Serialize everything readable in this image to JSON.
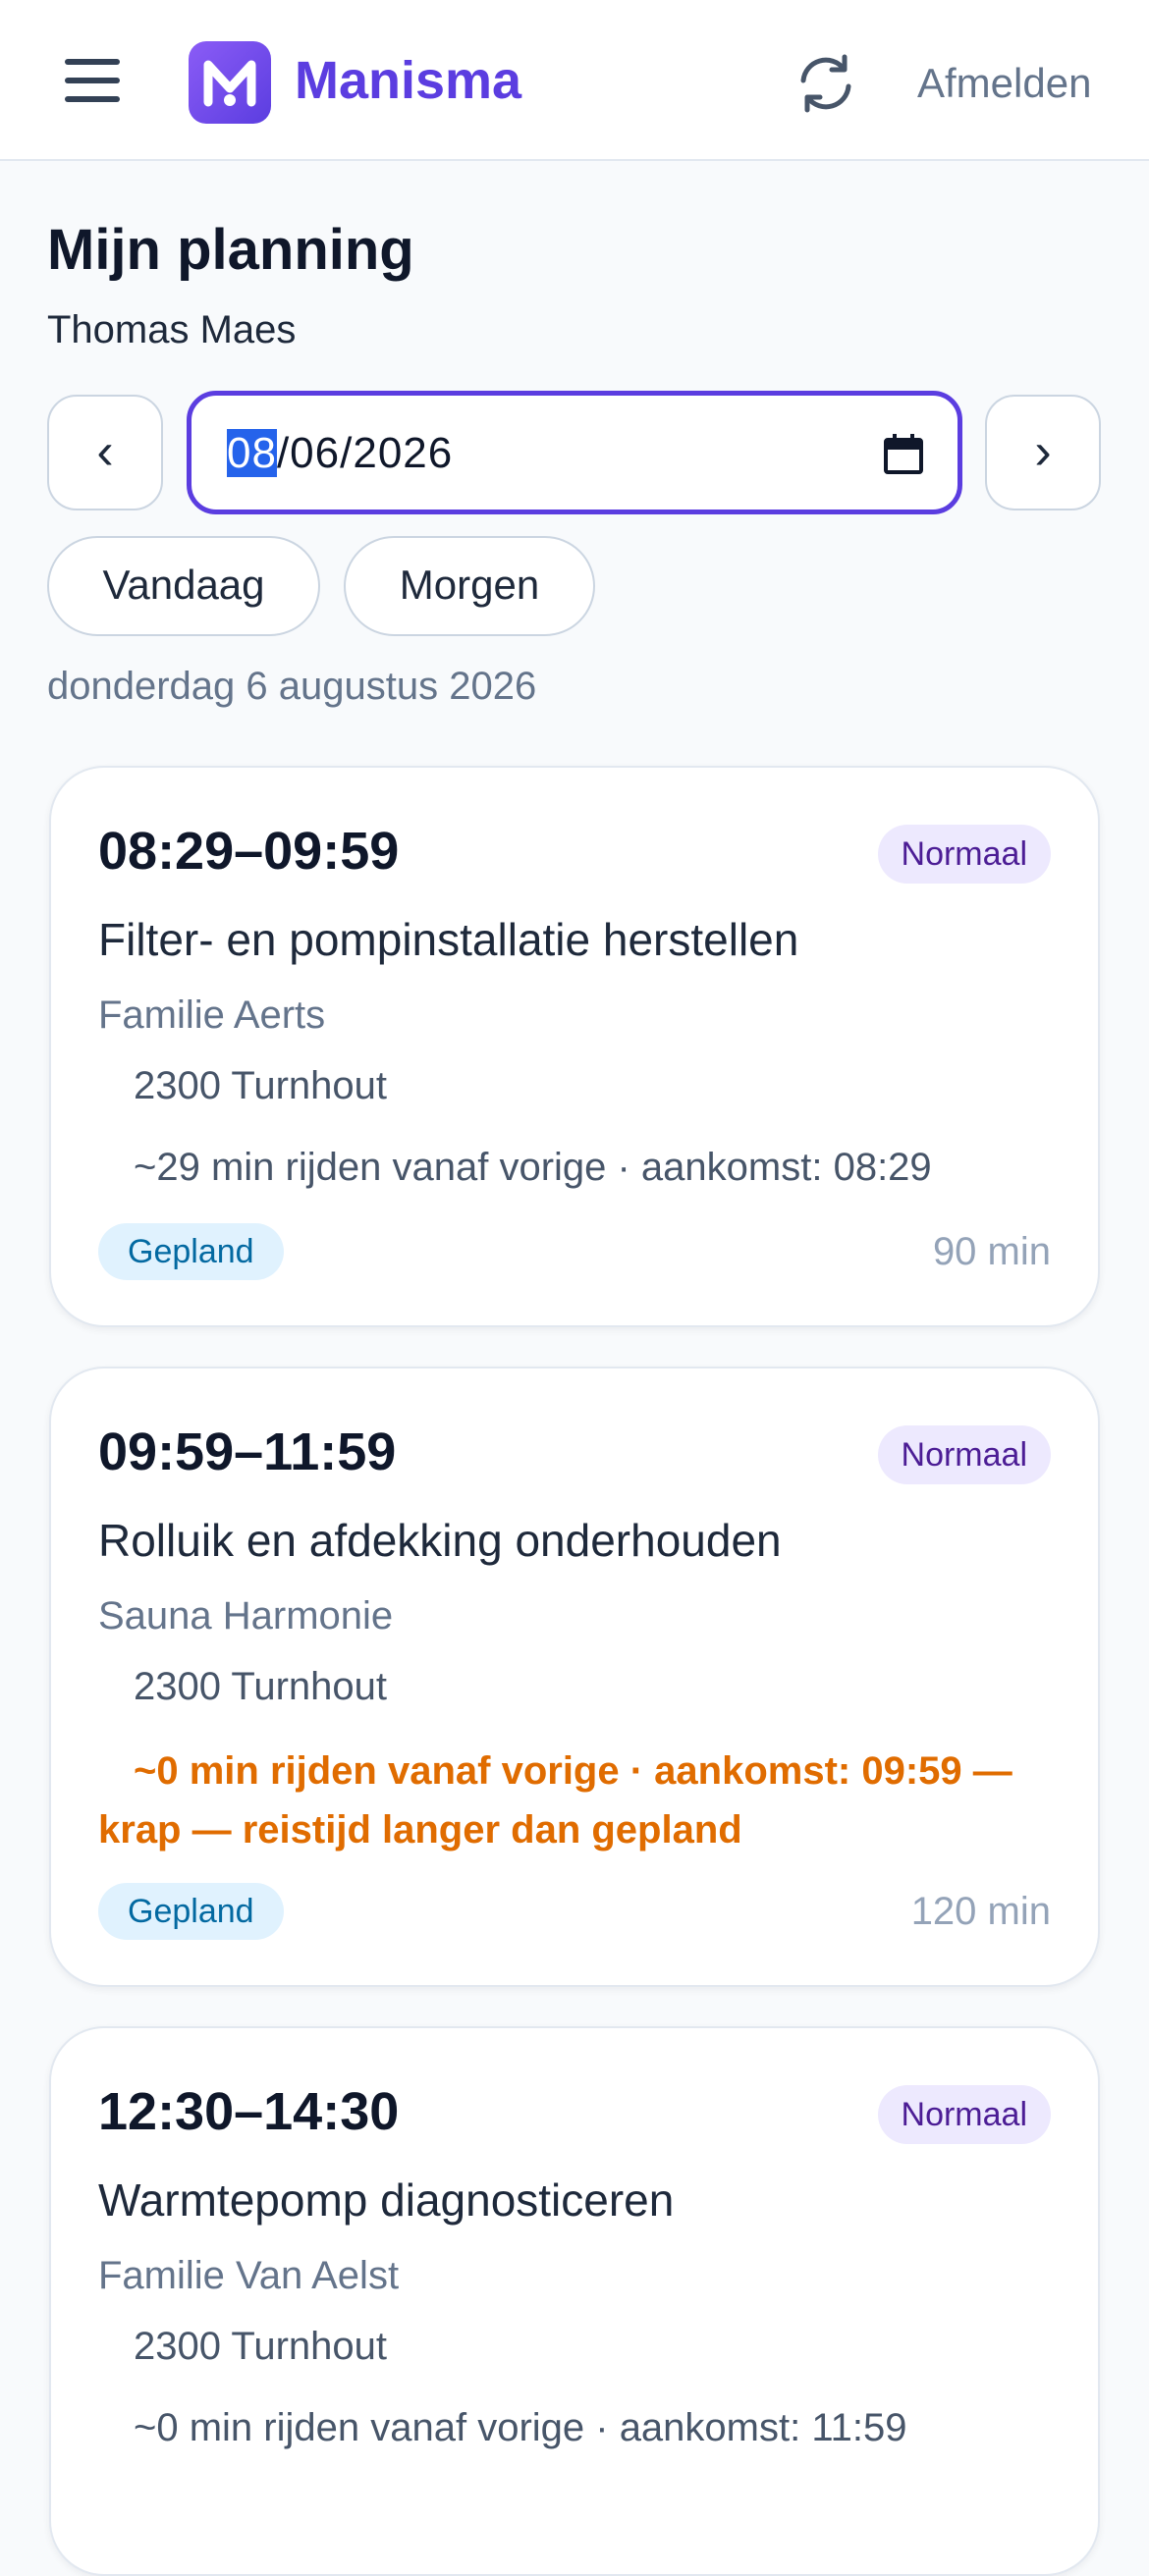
{
  "header": {
    "brand": "Manisma",
    "logout_label": "Afmelden",
    "icons": [
      "menu-icon",
      "manisma-logo",
      "refresh-icon"
    ]
  },
  "page": {
    "title": "Mijn planning",
    "user_name": "Thomas Maes"
  },
  "date_picker": {
    "prev_label": "‹",
    "next_label": "›",
    "day_part": "08",
    "rest_part": "/06/2026",
    "calendar_icon": "calendar-icon"
  },
  "quick_chips": {
    "today": "Vandaag",
    "tomorrow": "Morgen"
  },
  "selected_day_label": "donderdag 6 augustus 2026",
  "colors": {
    "brand": "#5b3de0",
    "warning": "#e06c00",
    "priority_bg": "#ede9fe",
    "status_bg": "#e0f2fe"
  },
  "appointments": [
    {
      "time": "08:29–09:59",
      "priority": "Normaal",
      "job": "Filter- en pompinstallatie herstellen",
      "client": "Familie Aerts",
      "city": "2300 Turnhout",
      "travel": "~29 min rijden vanaf vorige · aankomst: 08:29",
      "status": "Gepland",
      "duration": "90 min"
    },
    {
      "time": "09:59–11:59",
      "priority": "Normaal",
      "job": "Rolluik en afdekking onderhouden",
      "client": "Sauna Harmonie",
      "city": "2300 Turnhout",
      "travel": "~0 min rijden vanaf vorige · aankomst: 09:59 — krap — reistijd langer dan gepland",
      "status": "Gepland",
      "duration": "120 min"
    },
    {
      "time": "12:30–14:30",
      "priority": "Normaal",
      "job": "Warmtepomp diagnosticeren",
      "client": "Familie Van Aelst",
      "city": "2300 Turnhout",
      "travel": "~0 min rijden vanaf vorige · aankomst: 11:59"
    }
  ]
}
